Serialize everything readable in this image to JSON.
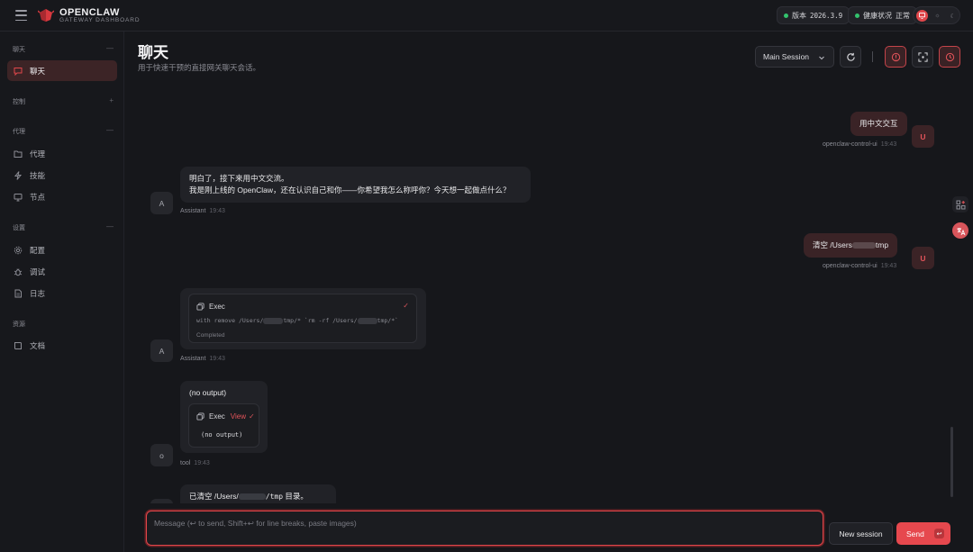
{
  "app": {
    "name": "OPENCLAW",
    "subtitle": "GATEWAY DASHBOARD",
    "accent": "#e0464a"
  },
  "topbar": {
    "version_label": "版本",
    "version_value": "2026.3.9",
    "health_label": "健康状况",
    "health_value": "正常",
    "status_color": "#33c36d",
    "theme_options": [
      "monitor-icon",
      "sun-icon",
      "moon-icon"
    ]
  },
  "sidebar": {
    "groups": [
      {
        "label": "聊天",
        "items": [
          {
            "label": "聊天",
            "icon": "chat-bubble-icon",
            "active": true
          }
        ]
      },
      {
        "label": "控制",
        "items": []
      },
      {
        "label": "代理",
        "items": [
          {
            "label": "代理",
            "icon": "folder-icon"
          },
          {
            "label": "技能",
            "icon": "lightning-icon"
          },
          {
            "label": "节点",
            "icon": "monitor-icon"
          }
        ]
      },
      {
        "label": "设置",
        "items": [
          {
            "label": "配置",
            "icon": "gear-icon"
          },
          {
            "label": "调试",
            "icon": "bug-icon"
          },
          {
            "label": "日志",
            "icon": "file-text-icon"
          }
        ]
      },
      {
        "label": "资源",
        "items": [
          {
            "label": "文档",
            "icon": "book-icon"
          }
        ]
      }
    ]
  },
  "header": {
    "title": "聊天",
    "subtitle": "用于快速干预的直接网关聊天会话。",
    "session_select": "Main Session"
  },
  "messages": [
    {
      "role": "user",
      "avatar": "U",
      "text": "用中文交互",
      "sender": "openclaw-control-ui",
      "time": "19:43"
    },
    {
      "role": "assistant",
      "avatar": "A",
      "line1": "明白了，接下来用中文交流。",
      "line2": "我是刚上线的 OpenClaw，还在认识自己和你——你希望我怎么称呼你？今天想一起做点什么？",
      "sender": "Assistant",
      "time": "19:43"
    },
    {
      "role": "user",
      "avatar": "U",
      "text_pre": "清空 /Users",
      "text_post": "tmp",
      "sender": "openclaw-control-ui",
      "time": "19:43"
    },
    {
      "role": "assistant",
      "avatar": "A",
      "tool": "Exec",
      "cmd_a": "with remove /Users/",
      "cmd_b": "tmp/* `rm -rf /Users/",
      "cmd_c": "tmp/*`",
      "status": "Completed",
      "sender": "Assistant",
      "time": "19:43"
    },
    {
      "role": "tool",
      "avatar": "o",
      "text": "(no output)",
      "tool": "Exec",
      "view": "View",
      "output": "(no output)",
      "sender": "tool",
      "time": "19:43"
    },
    {
      "role": "assistant",
      "avatar": "A",
      "text_pre": "已清空 /Users/",
      "text_mid": "/tmp",
      "text_post": " 目录。"
    }
  ],
  "composer": {
    "placeholder": "Message (↩ to send, Shift+↩ for line breaks, paste images)",
    "new_session": "New session",
    "send": "Send",
    "send_kbd": "↩"
  }
}
